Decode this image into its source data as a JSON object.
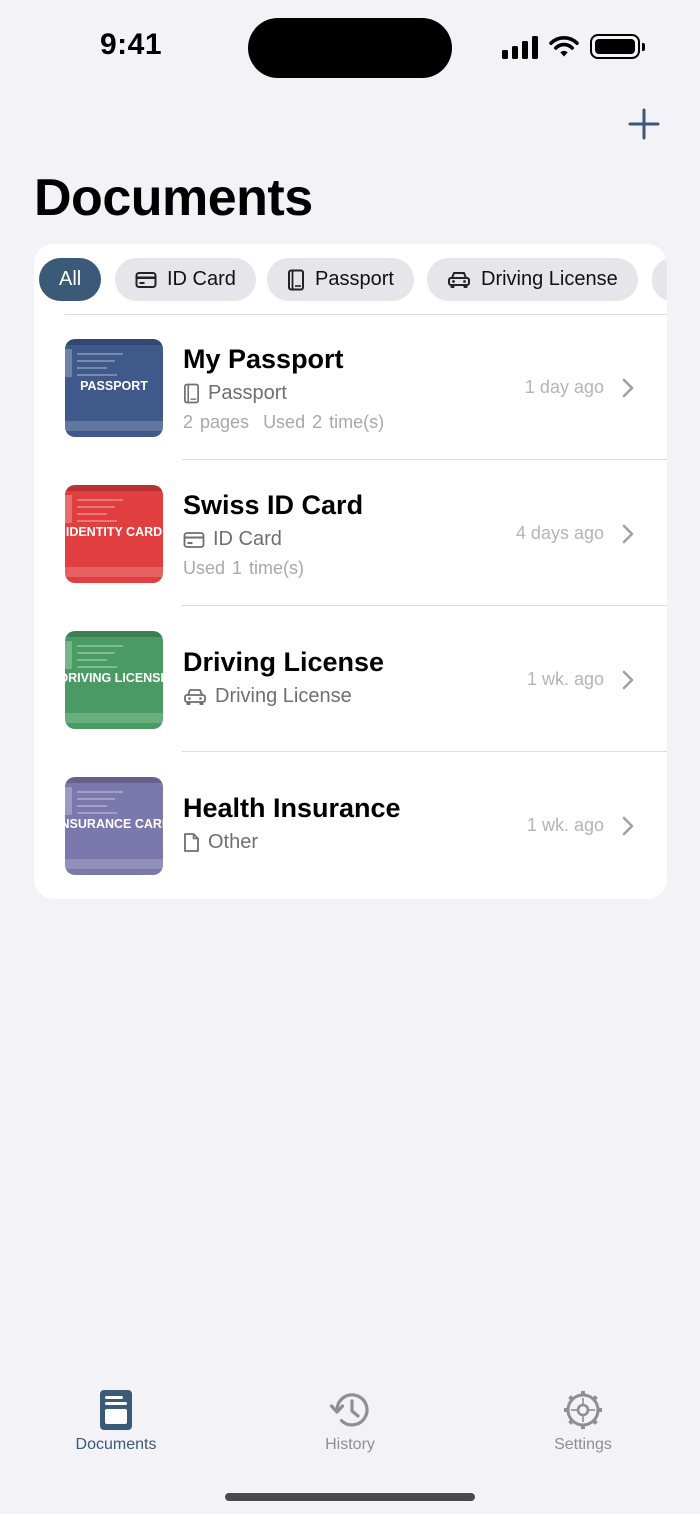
{
  "status_bar": {
    "time": "9:41"
  },
  "header": {
    "title": "Documents",
    "add_icon": "plus-icon"
  },
  "filters": [
    {
      "label": "All",
      "icon": "",
      "active": true
    },
    {
      "label": "ID Card",
      "icon": "id-card-icon",
      "active": false
    },
    {
      "label": "Passport",
      "icon": "book-icon",
      "active": false
    },
    {
      "label": "Driving License",
      "icon": "car-icon",
      "active": false
    }
  ],
  "documents": [
    {
      "title": "My Passport",
      "thumb_label": "PASSPORT",
      "thumb_color": "#3f5a8a",
      "type": "Passport",
      "type_icon": "book-icon",
      "meta": [
        "2 pages",
        "Used 2 time(s)"
      ],
      "time": "1 day ago"
    },
    {
      "title": "Swiss ID Card",
      "thumb_label": "IDENTITY CARD",
      "thumb_color": "#e13e3f",
      "type": "ID Card",
      "type_icon": "id-card-icon",
      "meta": [
        "Used 1 time(s)"
      ],
      "time": "4 days ago"
    },
    {
      "title": "Driving License",
      "thumb_label": "DRIVING LICENSE",
      "thumb_color": "#4a9b63",
      "type": "Driving License",
      "type_icon": "car-icon",
      "meta": [],
      "time": "1 wk. ago"
    },
    {
      "title": "Health Insurance",
      "thumb_label": "INSURANCE CARD",
      "thumb_color": "#7a78ac",
      "type": "Other",
      "type_icon": "file-icon",
      "meta": [],
      "time": "1 wk. ago"
    }
  ],
  "tabbar": [
    {
      "label": "Documents",
      "icon": "documents-icon",
      "active": true
    },
    {
      "label": "History",
      "icon": "history-icon",
      "active": false
    },
    {
      "label": "Settings",
      "icon": "gear-icon",
      "active": false
    }
  ],
  "colors": {
    "accent": "#3a5a78",
    "background": "#f2f2f7"
  }
}
